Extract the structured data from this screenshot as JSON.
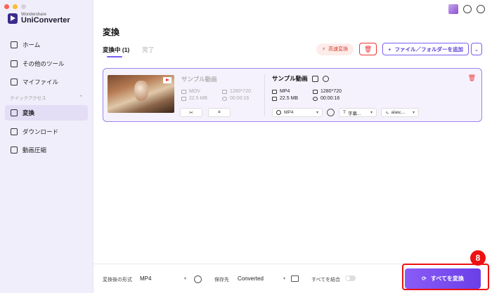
{
  "brand": {
    "small": "Wondershare",
    "big": "UniConverter"
  },
  "sidebar": {
    "items": [
      {
        "label": "ホーム",
        "icon": "home-icon"
      },
      {
        "label": "その他のツール",
        "icon": "toolbox-icon"
      },
      {
        "label": "マイファイル",
        "icon": "file-icon"
      }
    ],
    "section_label": "クイックアクセス",
    "section_add": "+",
    "quick": [
      {
        "label": "変換",
        "icon": "convert-icon",
        "active": true
      },
      {
        "label": "ダウンロード",
        "icon": "download-icon"
      },
      {
        "label": "動画圧縮",
        "icon": "compress-icon"
      }
    ]
  },
  "main": {
    "title": "変換",
    "tabs": {
      "active": "変換中 (1)",
      "done": "完了"
    },
    "high_speed": "高速変換",
    "add_files": "ファイル／フォルダーを追加"
  },
  "card": {
    "source": {
      "title": "サンプル動画",
      "format": "MOV",
      "resolution": "1280*720",
      "size": "22.5 MB",
      "duration": "00:00:16"
    },
    "target": {
      "title": "サンプル動画",
      "format": "MP4",
      "resolution": "1280*720",
      "size": "22.5 MB",
      "duration": "00:00:16",
      "format_select": "MP4",
      "subtitle_select": "字幕...",
      "audio_select": "alaw,..."
    }
  },
  "bottom": {
    "output_format_label": "変換後の形式",
    "output_format_value": "MP4",
    "save_to_label": "保存先",
    "save_to_value": "Converted",
    "merge_label": "すべてを結合",
    "convert_all": "すべてを変換"
  },
  "annotation": {
    "step": "8"
  },
  "colors": {
    "accent": "#7b5cf0",
    "danger": "#e11111"
  }
}
